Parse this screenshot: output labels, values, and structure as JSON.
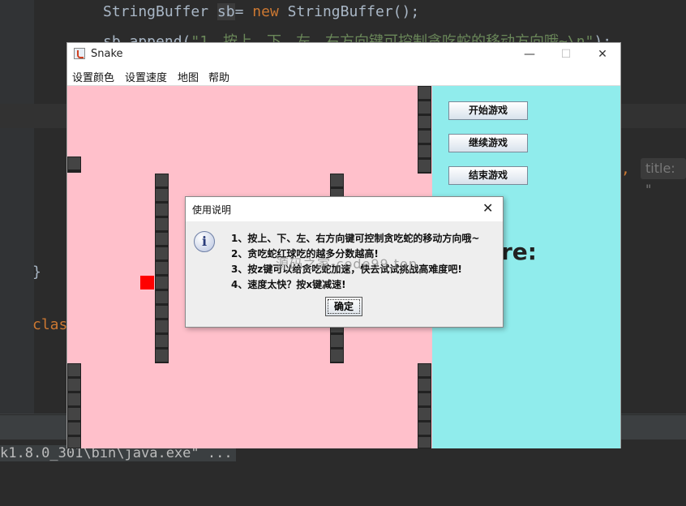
{
  "ide": {
    "line1_prefix": "StringBuffer ",
    "line1_var": "sb",
    "line1_mid": "= ",
    "line1_kw": "new",
    "line1_suffix": " StringBuffer();",
    "line2_prefix": "sb.append(",
    "line2_string": "\"1、按上、下、左、右方向键可控制贪吃蛇的移动方向哦~\\n\"",
    "line2_suffix": ");",
    "line_close": "}",
    "line_class": "clas",
    "param_comma": ",",
    "param_hint": "title: \"",
    "console": "k1.8.0_301\\bin\\java.exe\" ..."
  },
  "window": {
    "title": "Snake",
    "menus": [
      "设置颜色",
      "设置速度",
      "地图",
      "帮助"
    ],
    "minimize_glyph": "—",
    "maximize_glyph": "☐",
    "close_glyph": "✕"
  },
  "game": {
    "buttons": [
      "开始游戏",
      "继续游戏",
      "结束游戏"
    ],
    "score_label": "re:",
    "colors": {
      "field": "#ffc0cb",
      "panel": "#90ecec",
      "food": "#ff0000",
      "wall": "#444444"
    }
  },
  "dialog": {
    "title": "使用说明",
    "close_glyph": "✕",
    "info_glyph": "i",
    "lines": [
      "1、按上、下、左、右方向键可控制贪吃蛇的移动方向哦~",
      "2、贪吃蛇红球吃的越多分数越高!",
      "3、按z键可以给贪吃蛇加速，快去试试挑战高难度吧!",
      "4、速度太快？按x键减速!"
    ],
    "ok_label": "确定"
  },
  "watermark": "源码之家-code99.top"
}
